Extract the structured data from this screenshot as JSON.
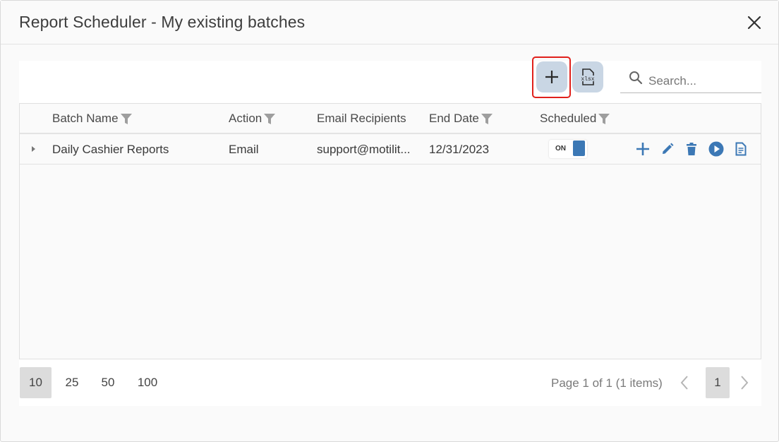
{
  "dialog": {
    "title": "Report Scheduler - My existing batches",
    "close_icon": "close-icon"
  },
  "toolbar": {
    "add_icon": "plus-icon",
    "export_icon": "xlsx-file-icon",
    "export_icon_text": "xlsx",
    "search": {
      "placeholder": "Search...",
      "value": ""
    }
  },
  "grid": {
    "columns": [
      {
        "label": "Batch Name",
        "filterable": true
      },
      {
        "label": "Action",
        "filterable": true
      },
      {
        "label": "Email Recipients",
        "filterable": false
      },
      {
        "label": "End Date",
        "filterable": true
      },
      {
        "label": "Scheduled",
        "filterable": true
      }
    ],
    "rows": [
      {
        "batch_name": "Daily Cashier Reports",
        "action": "Email",
        "email_recipients": "support@motilit...",
        "end_date": "12/31/2023",
        "scheduled": {
          "label": "ON",
          "on": true
        },
        "actions": [
          "plus-icon",
          "pencil-icon",
          "trash-icon",
          "play-circle-icon",
          "document-icon"
        ]
      }
    ]
  },
  "pager": {
    "page_sizes": [
      "10",
      "25",
      "50",
      "100"
    ],
    "selected_page_size": "10",
    "info": "Page 1 of 1 (1 items)",
    "current_page": "1"
  },
  "colors": {
    "accent": "#3c78b5",
    "button_bg": "#c9d6e4",
    "highlight_outline": "#e0201b",
    "filter_icon": "#9e9e9e"
  }
}
